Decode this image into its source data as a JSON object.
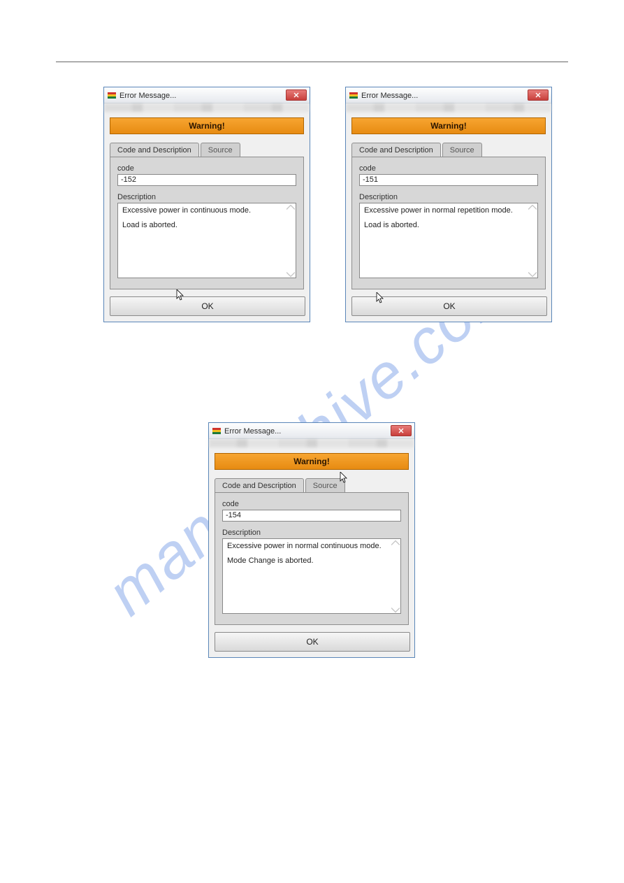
{
  "watermark": "manualshive.com",
  "dialogs": [
    {
      "window_title": "Error Message...",
      "banner": "Warning!",
      "tabs": {
        "active": "Code and Description",
        "inactive": "Source"
      },
      "code_label": "code",
      "code_value": "-152",
      "desc_label": "Description",
      "description_line1": "Excessive power in continuous mode.",
      "description_line2": "Load is aborted.",
      "ok_label": "OK"
    },
    {
      "window_title": "Error Message...",
      "banner": "Warning!",
      "tabs": {
        "active": "Code and Description",
        "inactive": "Source"
      },
      "code_label": "code",
      "code_value": "-151",
      "desc_label": "Description",
      "description_line1": "Excessive power in normal repetition mode.",
      "description_line2": "Load is aborted.",
      "ok_label": "OK"
    },
    {
      "window_title": "Error Message...",
      "banner": "Warning!",
      "tabs": {
        "active": "Code and Description",
        "inactive": "Source"
      },
      "code_label": "code",
      "code_value": "-154",
      "desc_label": "Description",
      "description_line1": "Excessive power in normal continuous mode.",
      "description_line2": "Mode Change is aborted.",
      "ok_label": "OK"
    }
  ]
}
